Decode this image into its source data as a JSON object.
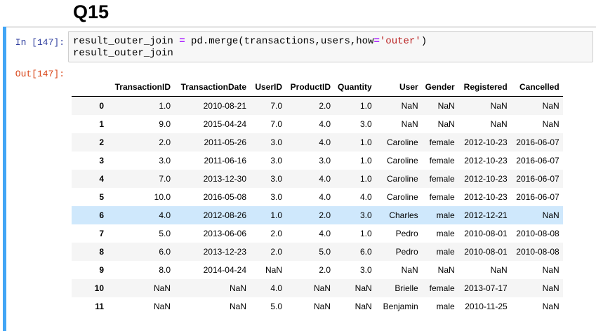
{
  "heading": "Q15",
  "cell": {
    "in_prompt": "In [147]:",
    "out_prompt": "Out[147]:",
    "code": {
      "line1": {
        "a": "result_outer_join ",
        "eq1": "=",
        "b": " pd.merge(transactions,users,how",
        "eq2": "=",
        "str": "'outer'",
        "c": ")"
      },
      "line2": "result_outer_join"
    }
  },
  "table": {
    "columns": [
      "",
      "TransactionID",
      "TransactionDate",
      "UserID",
      "ProductID",
      "Quantity",
      "User",
      "Gender",
      "Registered",
      "Cancelled"
    ],
    "rows": [
      [
        "0",
        "1.0",
        "2010-08-21",
        "7.0",
        "2.0",
        "1.0",
        "NaN",
        "NaN",
        "NaN",
        "NaN"
      ],
      [
        "1",
        "9.0",
        "2015-04-24",
        "7.0",
        "4.0",
        "3.0",
        "NaN",
        "NaN",
        "NaN",
        "NaN"
      ],
      [
        "2",
        "2.0",
        "2011-05-26",
        "3.0",
        "4.0",
        "1.0",
        "Caroline",
        "female",
        "2012-10-23",
        "2016-06-07"
      ],
      [
        "3",
        "3.0",
        "2011-06-16",
        "3.0",
        "3.0",
        "1.0",
        "Caroline",
        "female",
        "2012-10-23",
        "2016-06-07"
      ],
      [
        "4",
        "7.0",
        "2013-12-30",
        "3.0",
        "4.0",
        "1.0",
        "Caroline",
        "female",
        "2012-10-23",
        "2016-06-07"
      ],
      [
        "5",
        "10.0",
        "2016-05-08",
        "3.0",
        "4.0",
        "4.0",
        "Caroline",
        "female",
        "2012-10-23",
        "2016-06-07"
      ],
      [
        "6",
        "4.0",
        "2012-08-26",
        "1.0",
        "2.0",
        "3.0",
        "Charles",
        "male",
        "2012-12-21",
        "NaN"
      ],
      [
        "7",
        "5.0",
        "2013-06-06",
        "2.0",
        "4.0",
        "1.0",
        "Pedro",
        "male",
        "2010-08-01",
        "2010-08-08"
      ],
      [
        "8",
        "6.0",
        "2013-12-23",
        "2.0",
        "5.0",
        "6.0",
        "Pedro",
        "male",
        "2010-08-01",
        "2010-08-08"
      ],
      [
        "9",
        "8.0",
        "2014-04-24",
        "NaN",
        "2.0",
        "3.0",
        "NaN",
        "NaN",
        "NaN",
        "NaN"
      ],
      [
        "10",
        "NaN",
        "NaN",
        "4.0",
        "NaN",
        "NaN",
        "Brielle",
        "female",
        "2013-07-17",
        "NaN"
      ],
      [
        "11",
        "NaN",
        "NaN",
        "5.0",
        "NaN",
        "NaN",
        "Benjamin",
        "male",
        "2010-11-25",
        "NaN"
      ]
    ],
    "highlighted_row": 6
  },
  "colors": {
    "cell_bar": "#42a5f5",
    "in_prompt": "#303f9f",
    "out_prompt": "#d84315",
    "row_highlight": "#cfe8fc",
    "row_stripe": "#f5f5f5"
  }
}
